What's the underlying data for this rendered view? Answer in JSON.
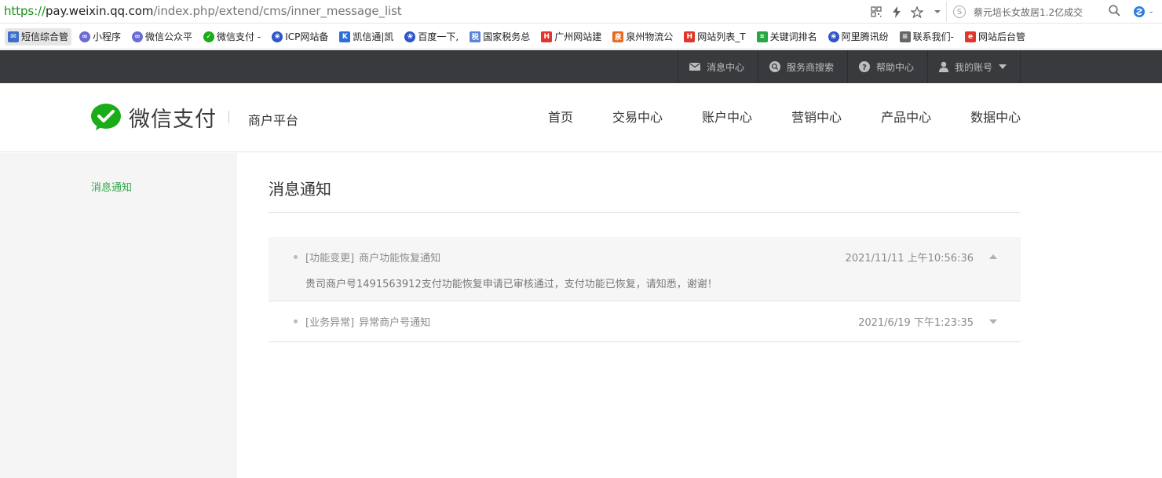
{
  "browser": {
    "url_scheme": "https://",
    "url_host": "pay.weixin.qq.com",
    "url_path": "/index.php/extend/cms/inner_message_list",
    "search_text": "蔡元培长女故居1.2亿成交",
    "icons": [
      "qr-code-icon",
      "lightning-icon",
      "star-icon",
      "chevron-down-icon",
      "search-icon",
      "extension-icon"
    ]
  },
  "bookmarks": [
    {
      "label": "短信综合管",
      "icon": "envelope",
      "color": "#3b6fc9"
    },
    {
      "label": "小程序",
      "icon": "link",
      "color": "#6b6bd6"
    },
    {
      "label": "微信公众平",
      "icon": "link",
      "color": "#6b6bd6"
    },
    {
      "label": "微信支付 -",
      "icon": "wechat-pay",
      "color": "#1aad19"
    },
    {
      "label": "ICP网站备",
      "icon": "paw",
      "color": "#2d55c8"
    },
    {
      "label": "凯信通|凯",
      "icon": "k",
      "color": "#2d6fd6"
    },
    {
      "label": "百度一下,",
      "icon": "paw",
      "color": "#2d55c8"
    },
    {
      "label": "国家税务总",
      "icon": "tax",
      "color": "#5a84d8"
    },
    {
      "label": "广州网站建",
      "icon": "h",
      "color": "#e2362c"
    },
    {
      "label": "泉州物流公",
      "icon": "logistics",
      "color": "#e86a1e"
    },
    {
      "label": "网站列表_T",
      "icon": "h",
      "color": "#e2362c"
    },
    {
      "label": "关键词排名",
      "icon": "crop",
      "color": "#28a745"
    },
    {
      "label": "阿里腾讯纷",
      "icon": "paw",
      "color": "#2d55c8"
    },
    {
      "label": "联系我们-",
      "icon": "doc",
      "color": "#666666"
    },
    {
      "label": "网站后台管",
      "icon": "ie",
      "color": "#e2362c"
    }
  ],
  "topnav": [
    {
      "label": "消息中心",
      "icon": "envelope-icon"
    },
    {
      "label": "服务商搜索",
      "icon": "search-circle-icon"
    },
    {
      "label": "帮助中心",
      "icon": "question-icon"
    },
    {
      "label": "我的账号",
      "icon": "user-icon"
    }
  ],
  "header": {
    "logo_text": "微信支付",
    "platform": "商户平台",
    "nav": [
      "首页",
      "交易中心",
      "账户中心",
      "营销中心",
      "产品中心",
      "数据中心"
    ]
  },
  "sidebar": {
    "items": [
      "消息通知"
    ]
  },
  "content": {
    "title": "消息通知",
    "messages": [
      {
        "category": "[功能变更]",
        "title": "商户功能恢复通知",
        "time": "2021/11/11 上午10:56:36",
        "body": "贵司商户号1491563912支付功能恢复申请已审核通过，支付功能已恢复，请知悉，谢谢！",
        "expanded": true
      },
      {
        "category": "[业务异常]",
        "title": "异常商户号通知",
        "time": "2021/6/19 下午1:23:35",
        "expanded": false
      }
    ]
  },
  "colors": {
    "brand_green": "#1aad19",
    "active_green": "#2fa74a",
    "topbar": "#393a3e"
  }
}
